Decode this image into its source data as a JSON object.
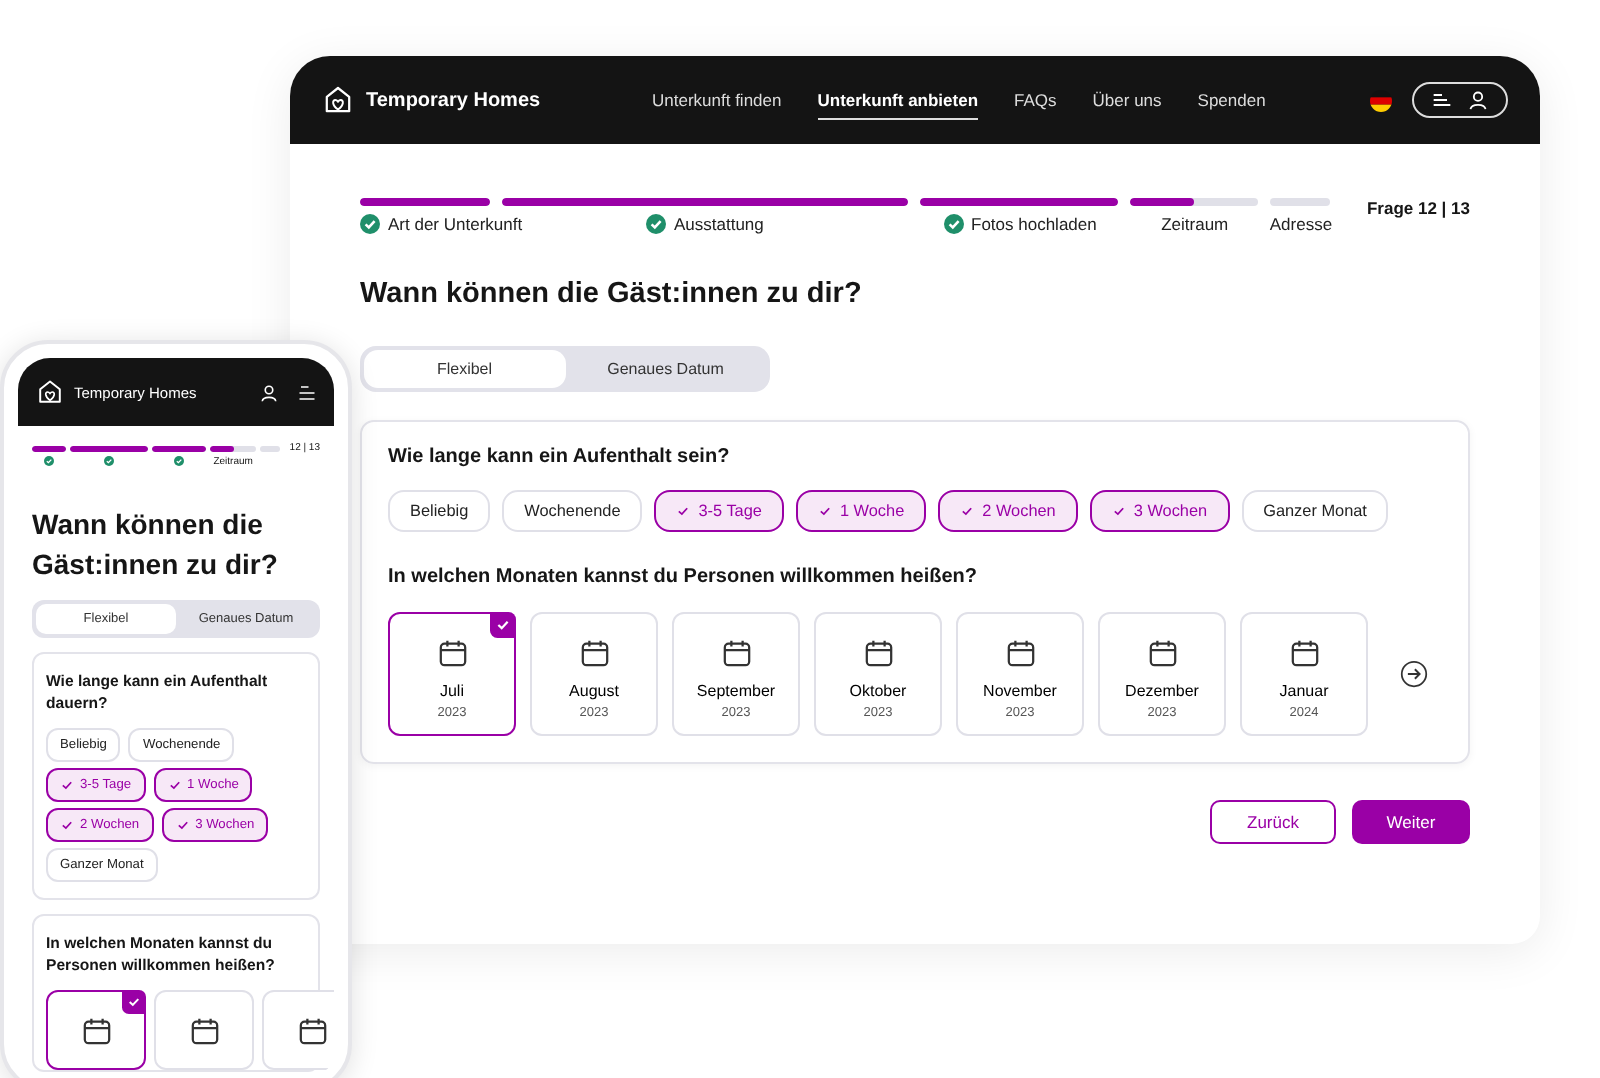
{
  "desktop": {
    "brand": "Temporary Homes",
    "nav": [
      {
        "label": "Unterkunft finden",
        "selected": false
      },
      {
        "label": "Unterkunft anbieten",
        "selected": true
      },
      {
        "label": "FAQs",
        "selected": false
      },
      {
        "label": "Über uns",
        "selected": false
      },
      {
        "label": "Spenden",
        "selected": false
      }
    ],
    "progress": [
      {
        "label": "Art der Unterkunft",
        "level": 1,
        "done": true
      },
      {
        "label": "Ausstattung",
        "level": 1,
        "done": true
      },
      {
        "label": "Fotos hochladen",
        "level": 1,
        "done": true
      },
      {
        "label": "Zeitraum",
        "level": 0.5,
        "done": false
      },
      {
        "label": "Adresse",
        "level": 0,
        "done": false
      }
    ],
    "counter": "Frage 12 | 13",
    "heading": "Wann können die Gäst:innen zu dir?",
    "toggle": [
      {
        "label": "Flexibel",
        "selected": true
      },
      {
        "label": "Genaues Datum",
        "selected": false
      }
    ],
    "question_duration": "Wie lange kann ein Aufenthalt sein?",
    "durations": [
      {
        "label": "Beliebig",
        "selected": false
      },
      {
        "label": "Wochenende",
        "selected": false
      },
      {
        "label": "3-5 Tage",
        "selected": true
      },
      {
        "label": "1 Woche",
        "selected": true
      },
      {
        "label": "2 Wochen",
        "selected": true
      },
      {
        "label": "3 Wochen",
        "selected": true
      },
      {
        "label": "Ganzer Monat",
        "selected": false
      }
    ],
    "question_months": "In welchen Monaten kannst du Personen willkommen heißen?",
    "months": [
      {
        "month": "Juli",
        "year": "2023",
        "selected": true
      },
      {
        "month": "August",
        "year": "2023",
        "selected": false
      },
      {
        "month": "September",
        "year": "2023",
        "selected": false
      },
      {
        "month": "Oktober",
        "year": "2023",
        "selected": false
      },
      {
        "month": "November",
        "year": "2023",
        "selected": false
      },
      {
        "month": "Dezember",
        "year": "2023",
        "selected": false
      },
      {
        "month": "Januar",
        "year": "2024",
        "selected": false
      }
    ],
    "back_button": "Zurück",
    "next_button": "Weiter"
  },
  "phone": {
    "brand": "Temporary Homes",
    "progress": [
      {
        "level": 1,
        "done": true
      },
      {
        "level": 1,
        "done": true
      },
      {
        "level": 1,
        "done": true
      },
      {
        "label": "Zeitraum",
        "level": 0.5,
        "done": false
      },
      {
        "level": 0,
        "done": false
      }
    ],
    "counter": "12 | 13",
    "heading": "Wann können die Gäst:innen zu dir?",
    "toggle": [
      {
        "label": "Flexibel",
        "selected": true
      },
      {
        "label": "Genaues Datum",
        "selected": false
      }
    ],
    "question_duration": "Wie lange kann ein Aufenthalt dauern?",
    "durations": [
      {
        "label": "Beliebig",
        "selected": false
      },
      {
        "label": "Wochenende",
        "selected": false
      },
      {
        "label": "3-5 Tage",
        "selected": true
      },
      {
        "label": "1 Woche",
        "selected": true
      },
      {
        "label": "2 Wochen",
        "selected": true
      },
      {
        "label": "3 Wochen",
        "selected": true
      },
      {
        "label": "Ganzer Monat",
        "selected": false
      }
    ],
    "question_months": "In welchen Monaten kannst du Personen willkommen heißen?",
    "months": [
      {
        "selected": true
      },
      {
        "selected": false
      },
      {
        "selected": false
      }
    ]
  }
}
